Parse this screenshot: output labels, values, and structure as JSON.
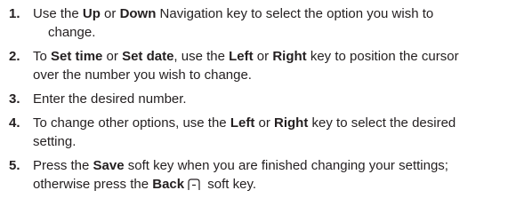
{
  "steps": [
    {
      "num": "1.",
      "line1": [
        {
          "t": "Use the "
        },
        {
          "t": "Up",
          "b": true
        },
        {
          "t": " or "
        },
        {
          "t": "Down",
          "b": true
        },
        {
          "t": " Navigation key to select the option you wish to"
        }
      ],
      "line2": [
        {
          "t": "change."
        }
      ]
    },
    {
      "num": "2.",
      "line1": [
        {
          "t": "To "
        },
        {
          "t": "Set time",
          "b": true
        },
        {
          "t": " or "
        },
        {
          "t": "Set date",
          "b": true
        },
        {
          "t": ", use the "
        },
        {
          "t": "Left",
          "b": true
        },
        {
          "t": " or "
        },
        {
          "t": "Right",
          "b": true
        },
        {
          "t": " key to position the cursor"
        }
      ],
      "line2": [
        {
          "t": "over the number you wish to change."
        }
      ]
    },
    {
      "num": "3.",
      "line1": [
        {
          "t": "Enter the desired number."
        }
      ]
    },
    {
      "num": "4.",
      "line1": [
        {
          "t": "To change other options, use the "
        },
        {
          "t": "Left",
          "b": true
        },
        {
          "t": " or "
        },
        {
          "t": "Right",
          "b": true
        },
        {
          "t": " key to select the desired"
        }
      ],
      "line2": [
        {
          "t": "setting."
        }
      ]
    },
    {
      "num": "5.",
      "line1": [
        {
          "t": "Press the "
        },
        {
          "t": "Save",
          "b": true
        },
        {
          "t": " soft key when you are finished changing your settings;"
        }
      ],
      "line2": [
        {
          "t": "otherwise press the "
        },
        {
          "t": "Back",
          "b": true
        },
        {
          "t": "",
          "icon": "right-softkey-icon"
        },
        {
          "t": " soft key."
        }
      ]
    }
  ]
}
